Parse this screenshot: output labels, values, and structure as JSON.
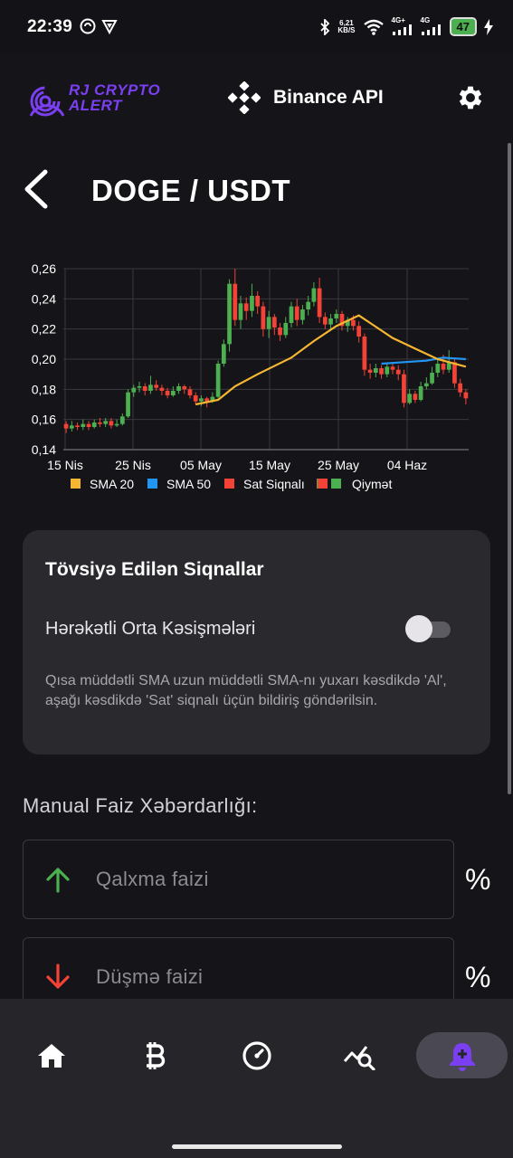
{
  "status_bar": {
    "time": "22:39",
    "net_speed_value": "6,21",
    "net_speed_unit": "KB/S",
    "sig1": "4G+",
    "sig2": "4G",
    "battery": "47"
  },
  "header": {
    "logo_line1": "RJ CRYPTO",
    "logo_line2": "ALERT",
    "exchange_label": "Binance API",
    "icons": {
      "exchange": "binance-icon",
      "settings": "gear-icon"
    }
  },
  "page": {
    "title": "DOGE / USDT"
  },
  "chart_data": {
    "type": "candlestick",
    "title": "",
    "y_ticks": [
      "0,26",
      "0,24",
      "0,22",
      "0,20",
      "0,18",
      "0,16",
      "0,14"
    ],
    "ylim": [
      0.14,
      0.26
    ],
    "x_ticks": [
      "15 Nis",
      "25 Nis",
      "05 May",
      "15 May",
      "25 May",
      "04 Haz"
    ],
    "legend": [
      {
        "label": "SMA 20",
        "color": "#f5b731"
      },
      {
        "label": "SMA 50",
        "color": "#2196f3"
      },
      {
        "label": "Sat Siqnalı",
        "color": "#f44336"
      },
      {
        "label": "Qiymət",
        "color": "#4caf50"
      }
    ],
    "legend_placement": "bottom",
    "grid": true,
    "candles": [
      [
        0.157,
        0.154,
        0.159,
        0.151
      ],
      [
        0.154,
        0.156,
        0.159,
        0.152
      ],
      [
        0.156,
        0.155,
        0.158,
        0.153
      ],
      [
        0.155,
        0.157,
        0.16,
        0.153
      ],
      [
        0.157,
        0.155,
        0.159,
        0.153
      ],
      [
        0.155,
        0.158,
        0.16,
        0.154
      ],
      [
        0.158,
        0.157,
        0.161,
        0.155
      ],
      [
        0.157,
        0.159,
        0.161,
        0.155
      ],
      [
        0.159,
        0.156,
        0.161,
        0.154
      ],
      [
        0.156,
        0.157,
        0.16,
        0.155
      ],
      [
        0.157,
        0.162,
        0.164,
        0.156
      ],
      [
        0.162,
        0.178,
        0.18,
        0.161
      ],
      [
        0.178,
        0.181,
        0.183,
        0.175
      ],
      [
        0.181,
        0.182,
        0.185,
        0.178
      ],
      [
        0.182,
        0.179,
        0.184,
        0.176
      ],
      [
        0.179,
        0.183,
        0.189,
        0.177
      ],
      [
        0.183,
        0.181,
        0.186,
        0.179
      ],
      [
        0.181,
        0.179,
        0.183,
        0.176
      ],
      [
        0.179,
        0.176,
        0.181,
        0.174
      ],
      [
        0.176,
        0.179,
        0.182,
        0.175
      ],
      [
        0.179,
        0.182,
        0.184,
        0.177
      ],
      [
        0.182,
        0.18,
        0.183,
        0.177
      ],
      [
        0.18,
        0.176,
        0.182,
        0.174
      ],
      [
        0.176,
        0.172,
        0.178,
        0.17
      ],
      [
        0.172,
        0.174,
        0.176,
        0.169
      ],
      [
        0.174,
        0.172,
        0.175,
        0.168
      ],
      [
        0.172,
        0.175,
        0.178,
        0.171
      ],
      [
        0.175,
        0.197,
        0.199,
        0.174
      ],
      [
        0.197,
        0.21,
        0.213,
        0.195
      ],
      [
        0.21,
        0.25,
        0.253,
        0.205
      ],
      [
        0.25,
        0.226,
        0.26,
        0.222
      ],
      [
        0.226,
        0.237,
        0.242,
        0.22
      ],
      [
        0.237,
        0.232,
        0.241,
        0.226
      ],
      [
        0.232,
        0.242,
        0.25,
        0.228
      ],
      [
        0.242,
        0.235,
        0.245,
        0.23
      ],
      [
        0.235,
        0.22,
        0.238,
        0.215
      ],
      [
        0.22,
        0.228,
        0.232,
        0.214
      ],
      [
        0.228,
        0.221,
        0.23,
        0.216
      ],
      [
        0.221,
        0.216,
        0.224,
        0.212
      ],
      [
        0.216,
        0.224,
        0.228,
        0.214
      ],
      [
        0.224,
        0.235,
        0.238,
        0.221
      ],
      [
        0.235,
        0.226,
        0.24,
        0.222
      ],
      [
        0.226,
        0.233,
        0.236,
        0.223
      ],
      [
        0.233,
        0.238,
        0.242,
        0.229
      ],
      [
        0.238,
        0.247,
        0.251,
        0.235
      ],
      [
        0.247,
        0.228,
        0.254,
        0.224
      ],
      [
        0.228,
        0.223,
        0.231,
        0.22
      ],
      [
        0.223,
        0.227,
        0.23,
        0.219
      ],
      [
        0.227,
        0.23,
        0.233,
        0.224
      ],
      [
        0.23,
        0.222,
        0.232,
        0.219
      ],
      [
        0.222,
        0.226,
        0.228,
        0.218
      ],
      [
        0.226,
        0.222,
        0.229,
        0.219
      ],
      [
        0.222,
        0.215,
        0.225,
        0.211
      ],
      [
        0.215,
        0.193,
        0.217,
        0.189
      ],
      [
        0.193,
        0.191,
        0.197,
        0.187
      ],
      [
        0.191,
        0.194,
        0.197,
        0.188
      ],
      [
        0.194,
        0.19,
        0.196,
        0.187
      ],
      [
        0.19,
        0.195,
        0.197,
        0.188
      ],
      [
        0.195,
        0.193,
        0.198,
        0.19
      ],
      [
        0.193,
        0.19,
        0.196,
        0.186
      ],
      [
        0.19,
        0.171,
        0.193,
        0.168
      ],
      [
        0.171,
        0.177,
        0.18,
        0.17
      ],
      [
        0.177,
        0.173,
        0.179,
        0.171
      ],
      [
        0.173,
        0.182,
        0.185,
        0.172
      ],
      [
        0.182,
        0.184,
        0.188,
        0.18
      ],
      [
        0.184,
        0.191,
        0.195,
        0.183
      ],
      [
        0.191,
        0.197,
        0.2,
        0.188
      ],
      [
        0.197,
        0.193,
        0.203,
        0.19
      ],
      [
        0.193,
        0.198,
        0.206,
        0.191
      ],
      [
        0.198,
        0.184,
        0.2,
        0.181
      ],
      [
        0.184,
        0.178,
        0.187,
        0.175
      ],
      [
        0.178,
        0.174,
        0.18,
        0.17
      ]
    ],
    "sma20": [
      [
        23,
        0.17
      ],
      [
        27,
        0.173
      ],
      [
        30,
        0.182
      ],
      [
        34,
        0.19
      ],
      [
        40,
        0.201
      ],
      [
        44,
        0.212
      ],
      [
        48,
        0.222
      ],
      [
        52,
        0.229
      ],
      [
        54,
        0.224
      ],
      [
        58,
        0.214
      ],
      [
        62,
        0.207
      ],
      [
        66,
        0.2
      ],
      [
        71,
        0.195
      ]
    ],
    "sma50": [
      [
        56,
        0.197
      ],
      [
        60,
        0.198
      ],
      [
        64,
        0.199
      ],
      [
        67,
        0.201
      ],
      [
        71,
        0.2
      ]
    ]
  },
  "alerts_card": {
    "title": "Tövsiyə Edilən Siqnallar",
    "ma_cross_label": "Hərəkətli Orta Kəsişmələri",
    "ma_cross_enabled": false,
    "description": "Qısa müddətli SMA uzun müddətli SMA-nı yuxarı kəsdikdə 'Al', aşağı kəsdikdə 'Sat' siqnalı üçün bildiriş göndərilsin."
  },
  "manual": {
    "title": "Manual Faiz Xəbərdarlığı:",
    "rise_placeholder": "Qalxma faizi",
    "fall_placeholder": "Düşmə faizi",
    "rise_value": "",
    "fall_value": "",
    "percent_sign": "%",
    "rise_color": "#4caf50",
    "fall_color": "#f44336"
  },
  "bottom_nav": {
    "items": [
      {
        "icon": "home-icon",
        "active": false
      },
      {
        "icon": "bitcoin-icon",
        "active": false
      },
      {
        "icon": "dashboard-gauge-icon",
        "active": false
      },
      {
        "icon": "chart-search-icon",
        "active": false
      },
      {
        "icon": "alarm-bell-add-icon",
        "active": true
      }
    ],
    "active_color": "#7b3ff2"
  }
}
